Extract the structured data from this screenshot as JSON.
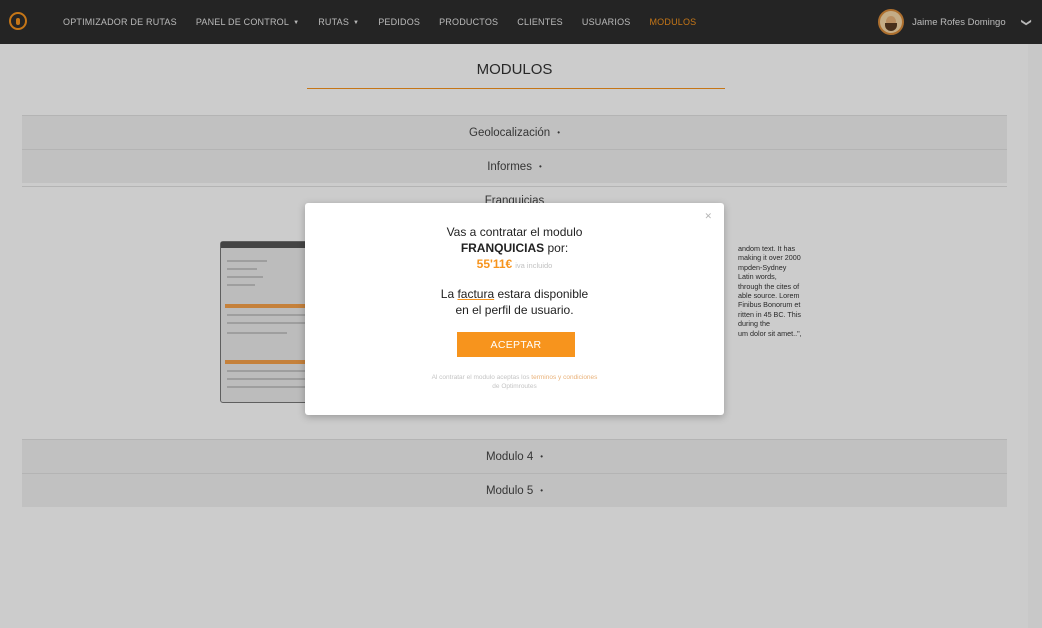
{
  "nav": {
    "items": [
      {
        "label": "OPTIMIZADOR DE RUTAS",
        "caret": false,
        "active": false
      },
      {
        "label": "PANEL DE CONTROL",
        "caret": true,
        "active": false
      },
      {
        "label": "RUTAS",
        "caret": true,
        "active": false
      },
      {
        "label": "PEDIDOS",
        "caret": false,
        "active": false
      },
      {
        "label": "PRODUCTOS",
        "caret": false,
        "active": false
      },
      {
        "label": "CLIENTES",
        "caret": false,
        "active": false
      },
      {
        "label": "USUARIOS",
        "caret": false,
        "active": false
      },
      {
        "label": "MODULOS",
        "caret": false,
        "active": true
      }
    ],
    "caret_glyph": "▼",
    "user_name": "Jaime Rofes Domingo",
    "user_chevron": "❯"
  },
  "page": {
    "title": "MODULOS",
    "rows": {
      "geolocalizacion": "Geolocalización",
      "informes": "Informes",
      "franquicias": "Franquicias",
      "modulo4": "Modulo 4",
      "modulo5": "Modulo 5"
    },
    "row_dot": "•",
    "lorem_lines": [
      "andom text. It has",
      "making it over 2000",
      "mpden-Sydney",
      "Latin words,",
      "through the cites of",
      "able source. Lorem",
      "Finibus Bonorum et",
      "ritten in 45 BC. This",
      "during the",
      "um dolor sit amet..\","
    ]
  },
  "modal": {
    "close": "✕",
    "line1": "Vas a contratar el modulo",
    "module_name": "FRANQUICIAS",
    "por": " por:",
    "price": "55'11€",
    "iva": "iva incluido",
    "factura_pre": "La ",
    "factura_word": "factura",
    "factura_post": " estara disponible",
    "line5": "en el perfil de usuario.",
    "accept_label": "ACEPTAR",
    "terms_pre": "Al contratar el modulo aceptas los ",
    "terms_link": "terminos y condiciones",
    "terms_line2": "de Optimroutes"
  },
  "colors": {
    "accent": "#f7941d",
    "topbar": "#2e2e2e"
  }
}
